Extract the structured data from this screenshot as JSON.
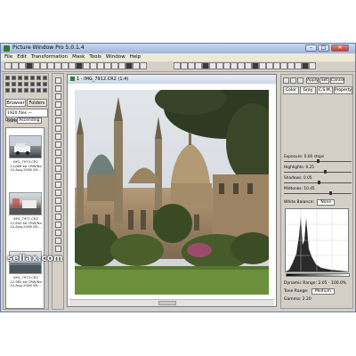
{
  "window": {
    "title": "Picture Window Pro 5.0.1.4",
    "controls": [
      "–",
      "□",
      "✕"
    ]
  },
  "menu": [
    "File",
    "Edit",
    "Transformation",
    "Mask",
    "Tools",
    "Window",
    "Help"
  ],
  "left_panel": {
    "tabs": [
      "Browser",
      "Folders"
    ],
    "path": "1920 files — 5,230.8...",
    "sort_label": "Date",
    "sort_value": "Ascending",
    "thumbnails": [
      {
        "name": "IMG_7970.CR2",
        "size": "14,889 kb CRW/No",
        "date": "10-Aug-2008 08:..."
      },
      {
        "name": "IMG_7971.CR2",
        "size": "12,600 kb CRW/No",
        "date": "10-Aug-2008 08:..."
      },
      {
        "name": "IMG_7973.CR2",
        "size": "12,982 kb CRW/No",
        "date": "10-Aug-2008 08:..."
      }
    ]
  },
  "image_window": {
    "title": "1 - IMG_7912.CR2 (1:4)"
  },
  "right_panel": {
    "top_buttons": [
      "Apply",
      "Set",
      "Cancel"
    ],
    "tabs": [
      "Color",
      "Gray",
      "C.S.M.",
      "Property"
    ],
    "sliders": [
      {
        "label": "Exposure: 0.00 stops",
        "level": 0.5
      },
      {
        "label": "Highlights: 0.25",
        "level": 0.62
      },
      {
        "label": "Shadows: 0.05",
        "level": 0.52
      },
      {
        "label": "Midtones: 10.45",
        "level": 0.7
      }
    ],
    "white_balance": {
      "label": "White Balance:",
      "value": "None"
    },
    "dynamic_range": "Dynamic Range: 2.05 - 100.0%",
    "tone_range": {
      "label": "Tone Range:",
      "value": "Medium"
    },
    "gamma": "Gamma: 2.20"
  },
  "watermark": "sellax.com",
  "colors": {
    "window_bg": "#d4d0c8",
    "title_gradient_top": "#c9d9ef",
    "close_button": "#c33a2c",
    "sky": "#d9dde3",
    "grass": "#6b8f3a"
  }
}
